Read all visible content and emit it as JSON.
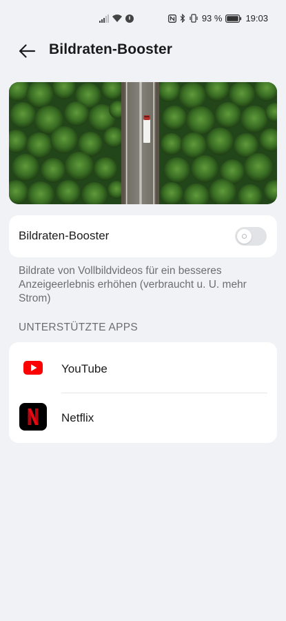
{
  "status_bar": {
    "battery_percent": "93 %",
    "time": "19:03"
  },
  "header": {
    "title": "Bildraten-Booster"
  },
  "booster": {
    "label": "Bildraten-Booster",
    "enabled": false,
    "description": "Bildrate von Vollbildvideos für ein besseres Anzeigeerlebnis erhöhen (verbraucht u. U. mehr Strom)"
  },
  "supported_apps": {
    "header": "UNTERSTÜTZTE APPS",
    "items": [
      {
        "name": "YouTube",
        "icon": "youtube-icon"
      },
      {
        "name": "Netflix",
        "icon": "netflix-icon"
      }
    ]
  },
  "colors": {
    "background": "#f1f2f6",
    "card": "#ffffff",
    "youtube_red": "#ff0000",
    "netflix_red": "#e50914",
    "secondary_text": "#6b6d72"
  }
}
